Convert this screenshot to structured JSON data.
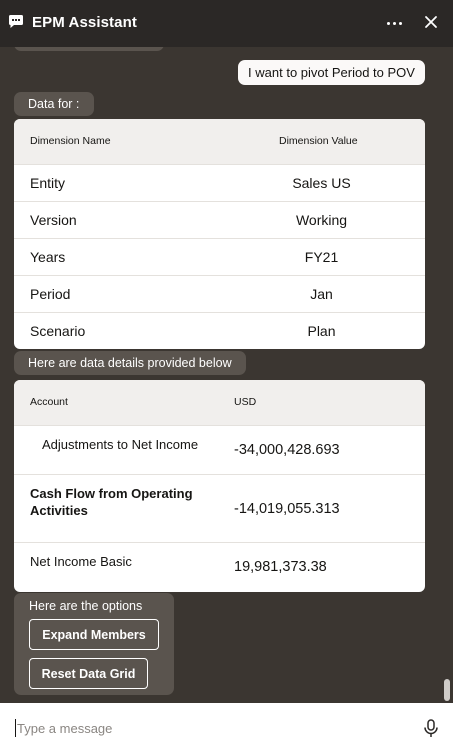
{
  "header": {
    "title": "EPM Assistant",
    "icons": {
      "chat": "chat-bubble-icon",
      "more": "more-options-icon",
      "close": "close-icon"
    }
  },
  "conversation": {
    "user_message": "I want to pivot Period to POV",
    "pov_label": "Data for :",
    "pov_table": {
      "headers": [
        "Dimension Name",
        "Dimension Value"
      ],
      "rows": [
        {
          "name": "Entity",
          "value": "Sales US"
        },
        {
          "name": "Version",
          "value": "Working"
        },
        {
          "name": "Years",
          "value": "FY21"
        },
        {
          "name": "Period",
          "value": "Jan"
        },
        {
          "name": "Scenario",
          "value": "Plan"
        }
      ]
    },
    "details_label": "Here are data details provided below",
    "details_table": {
      "headers": [
        "Account",
        "USD"
      ],
      "rows": [
        {
          "account": "Adjustments to Net Income",
          "usd": "-34,000,428.693"
        },
        {
          "account": "Cash Flow from Operating Activities",
          "usd": "-14,019,055.313"
        },
        {
          "account": "Net Income Basic",
          "usd": "19,981,373.38"
        }
      ]
    },
    "options": {
      "label": "Here are the options",
      "buttons": [
        "Expand Members",
        "Reset Data Grid"
      ]
    }
  },
  "input": {
    "placeholder": "Type a message",
    "icons": {
      "mic": "microphone-icon"
    }
  },
  "colors": {
    "header_bg": "#2b2826",
    "chat_bg": "#3b3631",
    "bot_bubble": "#5a544e",
    "user_bubble": "#fbf9f8",
    "table_header": "#f1efed"
  }
}
